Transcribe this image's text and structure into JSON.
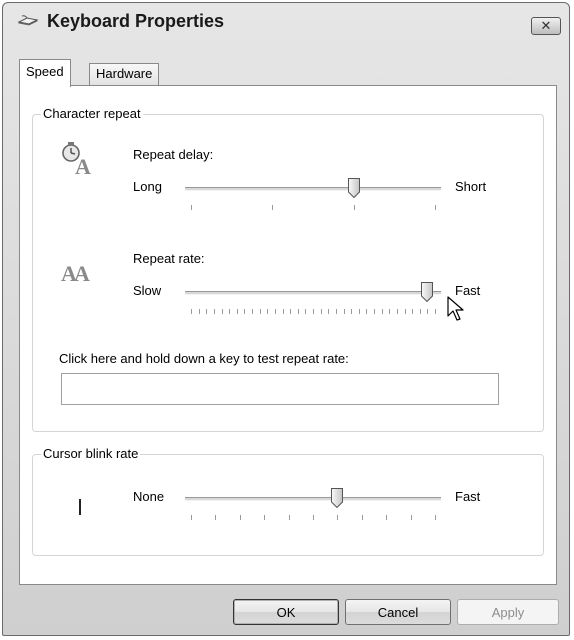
{
  "window": {
    "title": "Keyboard Properties",
    "title_icon": "keyboard-icon",
    "close_icon": "close-icon"
  },
  "tabs": [
    {
      "label": "Speed",
      "active": true
    },
    {
      "label": "Hardware",
      "active": false
    }
  ],
  "character_repeat": {
    "group_label": "Character repeat",
    "repeat_delay": {
      "icon": "repeat-delay-icon",
      "label": "Repeat delay:",
      "min_label": "Long",
      "max_label": "Short",
      "value": 2,
      "max": 3,
      "tick_count": 4
    },
    "repeat_rate": {
      "icon": "repeat-rate-icon",
      "icon_text": "AA",
      "label": "Repeat rate:",
      "min_label": "Slow",
      "max_label": "Fast",
      "value": 31,
      "max": 32,
      "tick_count": 33
    },
    "test_label": "Click here and hold down a key to test repeat rate:",
    "test_value": ""
  },
  "cursor_blink": {
    "group_label": "Cursor blink rate",
    "icon": "text-cursor-icon",
    "min_label": "None",
    "max_label": "Fast",
    "value": 6,
    "max": 10,
    "tick_count": 11
  },
  "buttons": {
    "ok": "OK",
    "cancel": "Cancel",
    "apply": "Apply"
  },
  "colors": {
    "window_chrome": "#d9d9d9",
    "panel": "#ffffff",
    "group_border": "#d5d5d5"
  }
}
